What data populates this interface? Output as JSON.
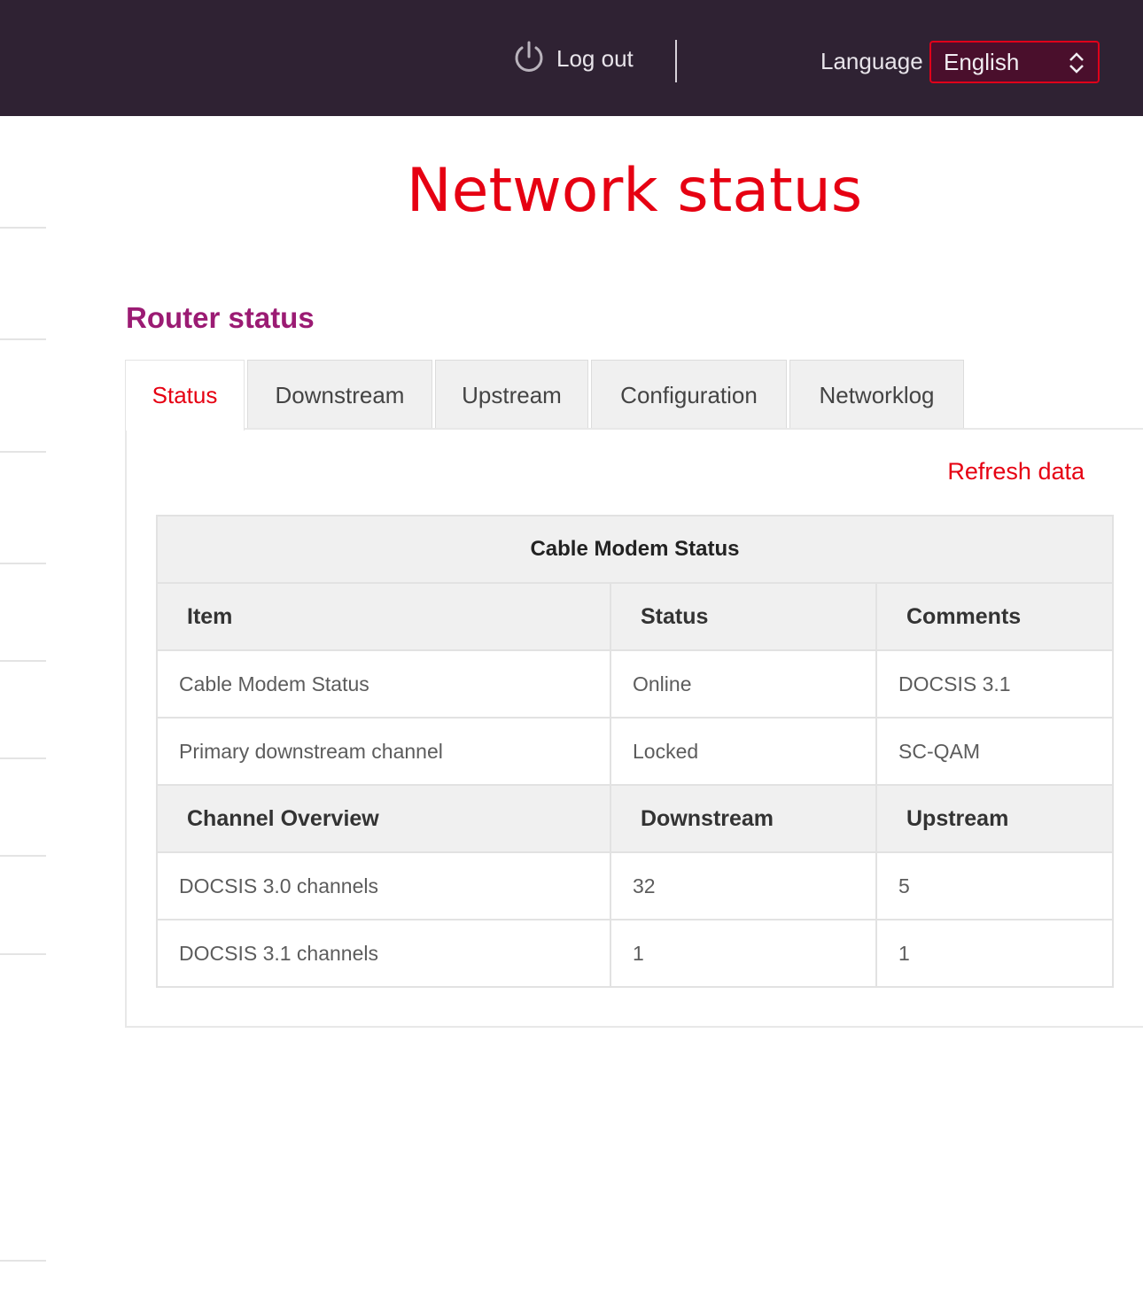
{
  "header": {
    "logout_label": "Log out",
    "logout_icon": "power-icon",
    "language_label": "Language",
    "language_selected": "English",
    "accent_color": "#e60012",
    "bar_color": "#2f2233"
  },
  "page_title": "Network status",
  "section_title": "Router status",
  "tabs": [
    {
      "label": "Status",
      "active": true
    },
    {
      "label": "Downstream",
      "active": false
    },
    {
      "label": "Upstream",
      "active": false
    },
    {
      "label": "Configuration",
      "active": false
    },
    {
      "label": "Networklog",
      "active": false
    }
  ],
  "refresh_label": "Refresh data",
  "table": {
    "caption": "Cable Modem Status",
    "header1": [
      "Item",
      "Status",
      "Comments"
    ],
    "rows1": [
      [
        "Cable Modem Status",
        "Online",
        "DOCSIS 3.1"
      ],
      [
        "Primary downstream channel",
        "Locked",
        "SC-QAM"
      ]
    ],
    "header2": [
      "Channel Overview",
      "Downstream",
      "Upstream"
    ],
    "rows2": [
      [
        "DOCSIS 3.0 channels",
        "32",
        "5"
      ],
      [
        "DOCSIS 3.1 channels",
        "1",
        "1"
      ]
    ]
  }
}
